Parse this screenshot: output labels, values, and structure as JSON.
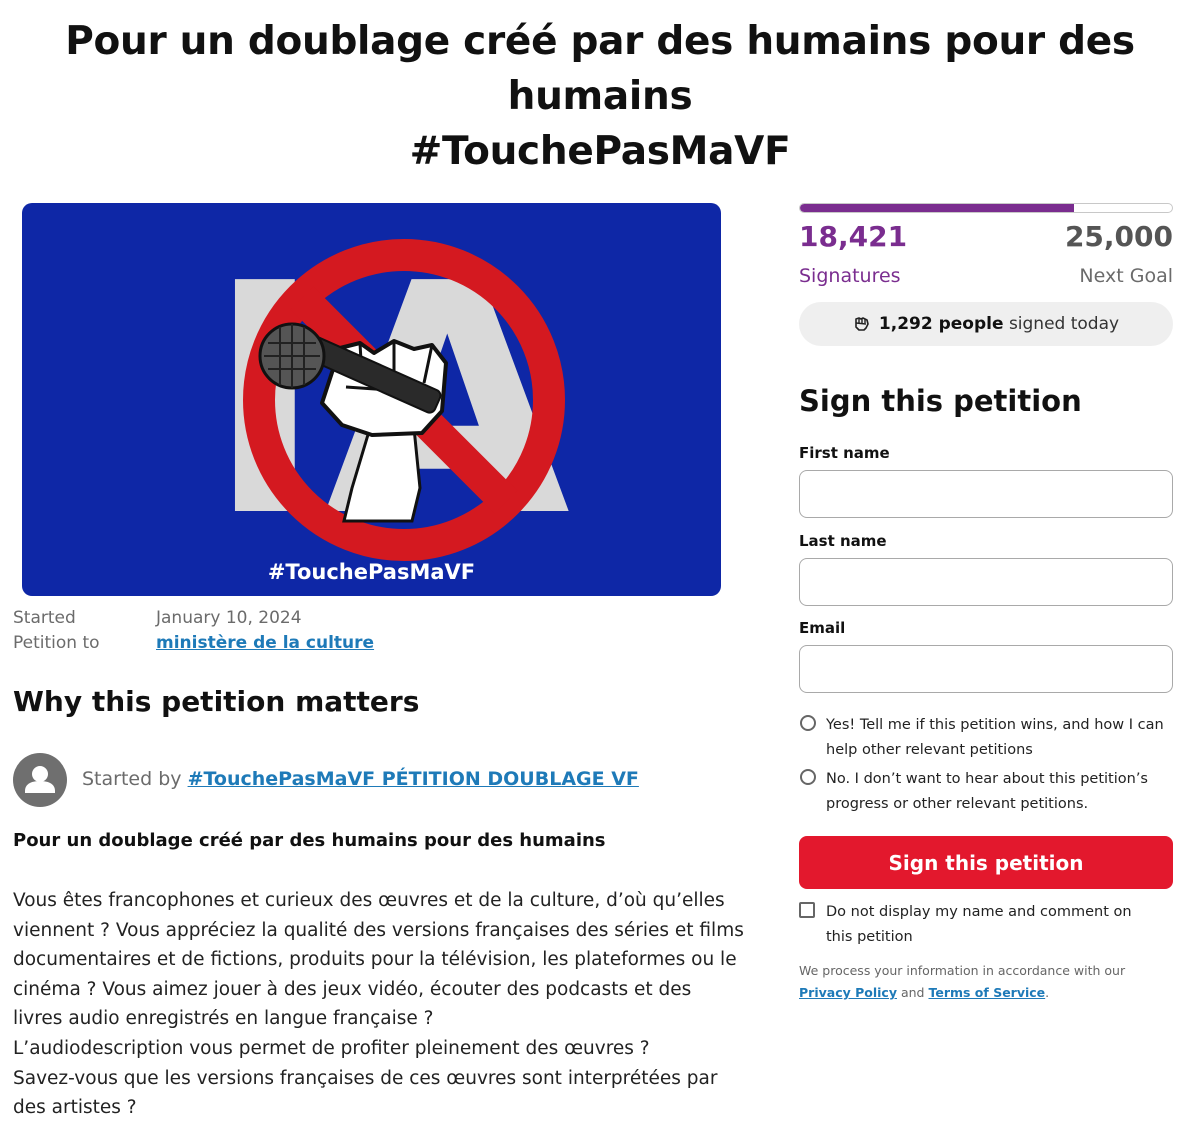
{
  "petition": {
    "title_line1": "Pour un doublage créé par des humains pour des humains",
    "title_line2": "#TouchePasMaVF"
  },
  "hero_image": {
    "caption": "#TouchePasMaVF",
    "logo_text": "IA",
    "colors": {
      "background": "#0e27a6",
      "prohibition_sign": "#d41920"
    },
    "icons": [
      "no-sign-icon",
      "fist-microphone-icon"
    ]
  },
  "meta": {
    "started_label": "Started",
    "started_value": "January 10, 2024",
    "petition_to_label": "Petition to",
    "petition_to_value": "ministère de la culture"
  },
  "why": {
    "heading": "Why this petition matters",
    "started_by_prefix": "Started by",
    "started_by_name": "#TouchePasMaVF PÉTITION DOUBLAGE VF",
    "body_heading": "Pour un doublage créé par des humains pour des humains",
    "body_lines": [
      "Vous êtes francophones et curieux des œuvres et de la culture, d’où qu’elles",
      "viennent ? Vous appréciez la qualité des versions françaises des séries et films",
      "documentaires et de fictions, produits pour la télévision, les plateformes ou le",
      "cinéma ? Vous aimez jouer à des jeux vidéo, écouter des podcasts et des",
      "livres audio enregistrés en langue française ?",
      "L’audiodescription vous permet de profiter pleinement des œuvres ?",
      "Savez-vous que les versions françaises de ces œuvres sont interprétées par",
      "des artistes ?"
    ]
  },
  "stats": {
    "signatures": "18,421",
    "signatures_label": "Signatures",
    "goal": "25,000",
    "goal_label": "Next Goal",
    "progress_fraction": 0.737,
    "today_count": "1,292 people",
    "today_suffix": "signed today",
    "accent_color": "#7a2d8f"
  },
  "form": {
    "heading": "Sign this petition",
    "first_name_label": "First name",
    "last_name_label": "Last name",
    "email_label": "Email",
    "option_yes": "Yes! Tell me if this petition wins, and how I can help other relevant petitions",
    "option_no": "No. I don’t want to hear about this petition’s progress or other relevant petitions.",
    "submit_label": "Sign this petition",
    "submit_color": "#e3182d",
    "hide_name_label": "Do not display my name and comment on this petition",
    "privacy_prefix": "We process your information in accordance with our",
    "privacy_link": "Privacy Policy",
    "privacy_and": "and",
    "terms_link": "Terms of Service",
    "privacy_end": "."
  }
}
